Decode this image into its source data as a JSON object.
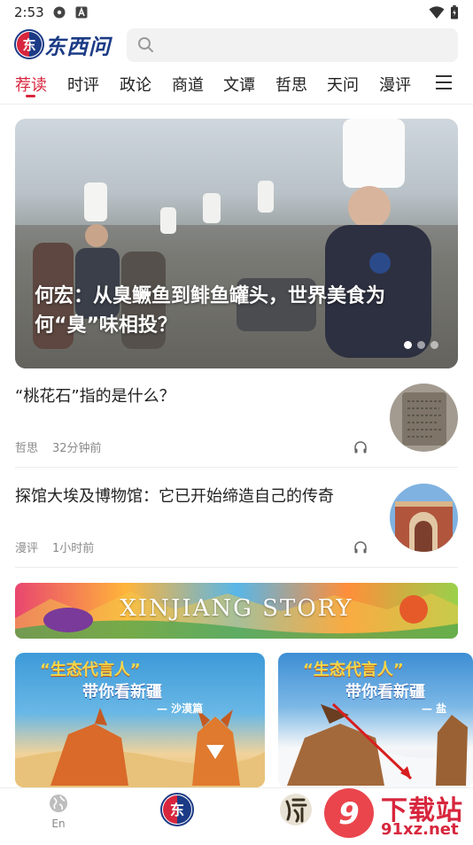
{
  "status_bar": {
    "time": "2:53",
    "icons": [
      "settings-icon",
      "a-icon",
      "wifi-icon",
      "battery-icon"
    ]
  },
  "header": {
    "logo_text": "东西问",
    "search_placeholder": ""
  },
  "tabs": [
    {
      "label": "荐读",
      "active": true
    },
    {
      "label": "时评"
    },
    {
      "label": "政论"
    },
    {
      "label": "商道"
    },
    {
      "label": "文谭"
    },
    {
      "label": "哲思"
    },
    {
      "label": "天问"
    },
    {
      "label": "漫评"
    }
  ],
  "hero": {
    "title": "何宏：从臭鳜鱼到鲱鱼罐头，世界美食为何“臭”味相投？",
    "slides": 3,
    "active_slide": 1
  },
  "news": [
    {
      "title": "“桃花石”指的是什么？",
      "category": "哲思",
      "time": "32分钟前"
    },
    {
      "title": "探馆大埃及博物馆：它已开始缔造自己的传奇",
      "category": "漫评",
      "time": "1小时前"
    }
  ],
  "banner": {
    "text": "XINJIANG STORY"
  },
  "cards": [
    {
      "title": "“生态代言人”",
      "subtitle": "带你看新疆",
      "tag": "— 沙漠篇"
    },
    {
      "title": "“生态代言人”",
      "subtitle": "带你看新疆",
      "tag": "— 盐"
    }
  ],
  "bottom_nav": [
    {
      "label": "En",
      "icon": "globe-icon"
    },
    {
      "label": "",
      "icon": "dongxiwen-logo-icon"
    },
    {
      "label": "",
      "icon": "hanxue-icon"
    }
  ],
  "watermark": {
    "brand": "下载站",
    "url": "91xz.net"
  },
  "colors": {
    "accent": "#d7263d",
    "brand_blue": "#1c3b86"
  }
}
